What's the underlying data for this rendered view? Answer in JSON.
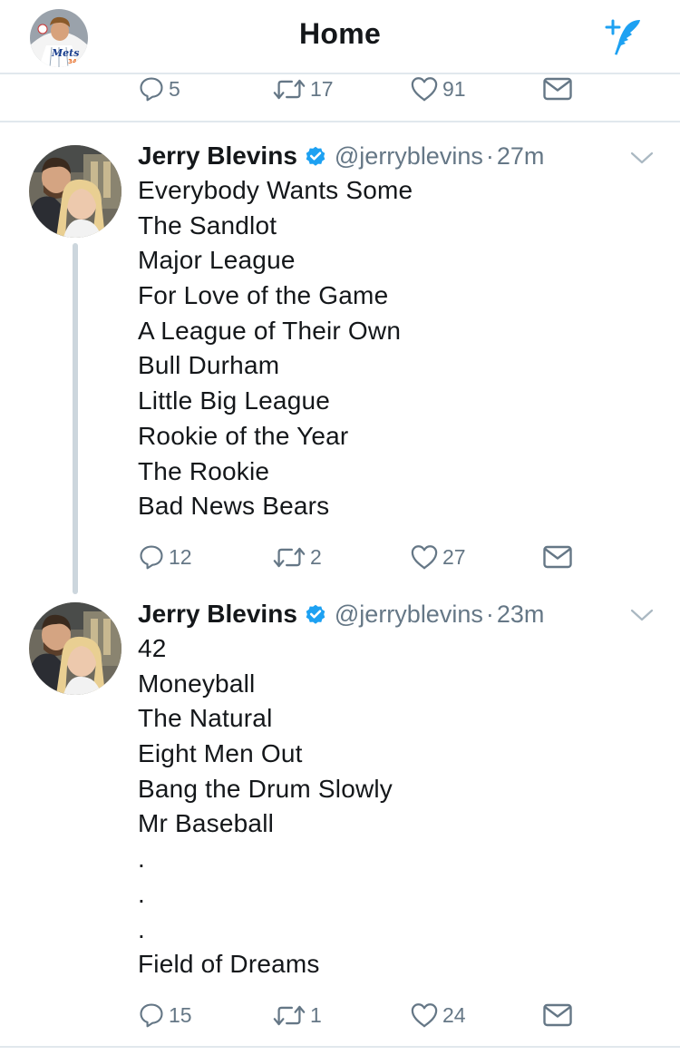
{
  "header": {
    "title": "Home",
    "avatar_icon": "profile-avatar-icon",
    "compose_icon": "compose-tweet-icon",
    "accent_color": "#1da1f2"
  },
  "previous_tweet_actions": {
    "reply_count": "5",
    "retweet_count": "17",
    "like_count": "91"
  },
  "tweets": [
    {
      "name": "Jerry Blevins",
      "handle": "@jerryblevins",
      "separator": "·",
      "time": "27m",
      "lines": [
        "Everybody Wants Some",
        "The Sandlot",
        "Major League",
        "For Love of the Game",
        "A League of Their Own",
        "Bull Durham",
        "Little Big League",
        "Rookie of the Year",
        "The Rookie",
        "Bad News Bears"
      ],
      "reply_count": "12",
      "retweet_count": "2",
      "like_count": "27"
    },
    {
      "name": "Jerry Blevins",
      "handle": "@jerryblevins",
      "separator": "·",
      "time": "23m",
      "lines": [
        "42",
        "Moneyball",
        "The Natural",
        "Eight Men Out",
        "Bang the Drum Slowly",
        "Mr Baseball",
        ".",
        ".",
        ".",
        "Field of Dreams"
      ],
      "reply_count": "15",
      "retweet_count": "1",
      "like_count": "24"
    }
  ]
}
